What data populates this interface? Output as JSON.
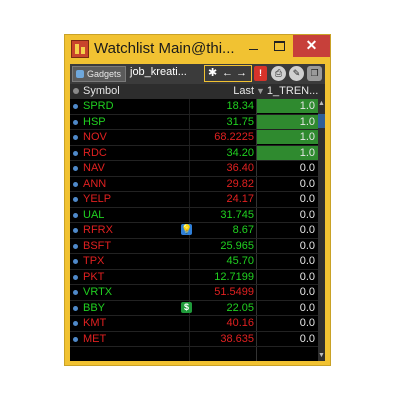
{
  "window": {
    "title": "Watchlist Main@thi...",
    "minimize_label": "–",
    "close_label": "✕"
  },
  "toolbar": {
    "gadgets_label": "Gadgets",
    "tab_label": "job_kreati...",
    "gear_glyph": "✱",
    "arrow_left_glyph": "←",
    "arrow_right_glyph": "→",
    "red_btn_glyph": "!",
    "print_glyph": "⎙",
    "pin_glyph": "✎",
    "copy_glyph": "❐"
  },
  "header": {
    "symbol": "Symbol",
    "last": "Last",
    "trend": "1_TREN..."
  },
  "colors": {
    "up": "#20d020",
    "down": "#e02020",
    "trend_on": "#2f8a2f"
  },
  "rows": [
    {
      "symbol": "SPRD",
      "last": "18.34",
      "trend": "1.0",
      "dir": "up",
      "sym_color": "up",
      "highlight": true
    },
    {
      "symbol": "HSP",
      "last": "31.75",
      "trend": "1.0",
      "dir": "up",
      "sym_color": "up",
      "highlight": true
    },
    {
      "symbol": "NOV",
      "last": "68.2225",
      "trend": "1.0",
      "dir": "down",
      "sym_color": "down",
      "highlight": true
    },
    {
      "symbol": "RDC",
      "last": "34.20",
      "trend": "1.0",
      "dir": "up",
      "sym_color": "down",
      "highlight": true
    },
    {
      "symbol": "NAV",
      "last": "36.40",
      "trend": "0.0",
      "dir": "down",
      "sym_color": "down",
      "highlight": false
    },
    {
      "symbol": "ANN",
      "last": "29.82",
      "trend": "0.0",
      "dir": "down",
      "sym_color": "down",
      "highlight": false
    },
    {
      "symbol": "YELP",
      "last": "24.17",
      "trend": "0.0",
      "dir": "down",
      "sym_color": "down",
      "highlight": false
    },
    {
      "symbol": "UAL",
      "last": "31.745",
      "trend": "0.0",
      "dir": "up",
      "sym_color": "up",
      "highlight": false
    },
    {
      "symbol": "RFRX",
      "last": "8.67",
      "trend": "0.0",
      "dir": "up",
      "sym_color": "down",
      "highlight": false,
      "flag": "bulb-icon",
      "flag_glyph": "💡",
      "flag_color": "#2f7fd8"
    },
    {
      "symbol": "BSFT",
      "last": "25.965",
      "trend": "0.0",
      "dir": "up",
      "sym_color": "down",
      "highlight": false
    },
    {
      "symbol": "TPX",
      "last": "45.70",
      "trend": "0.0",
      "dir": "up",
      "sym_color": "down",
      "highlight": false
    },
    {
      "symbol": "PKT",
      "last": "12.7199",
      "trend": "0.0",
      "dir": "up",
      "sym_color": "down",
      "highlight": false
    },
    {
      "symbol": "VRTX",
      "last": "51.5499",
      "trend": "0.0",
      "dir": "down",
      "sym_color": "up",
      "highlight": false
    },
    {
      "symbol": "BBY",
      "last": "22.05",
      "trend": "0.0",
      "dir": "up",
      "sym_color": "up",
      "highlight": false,
      "flag": "dollar-icon",
      "flag_glyph": "$",
      "flag_color": "#1f9a3a"
    },
    {
      "symbol": "KMT",
      "last": "40.16",
      "trend": "0.0",
      "dir": "down",
      "sym_color": "down",
      "highlight": false
    },
    {
      "symbol": "MET",
      "last": "38.635",
      "trend": "0.0",
      "dir": "down",
      "sym_color": "down",
      "highlight": false
    }
  ]
}
